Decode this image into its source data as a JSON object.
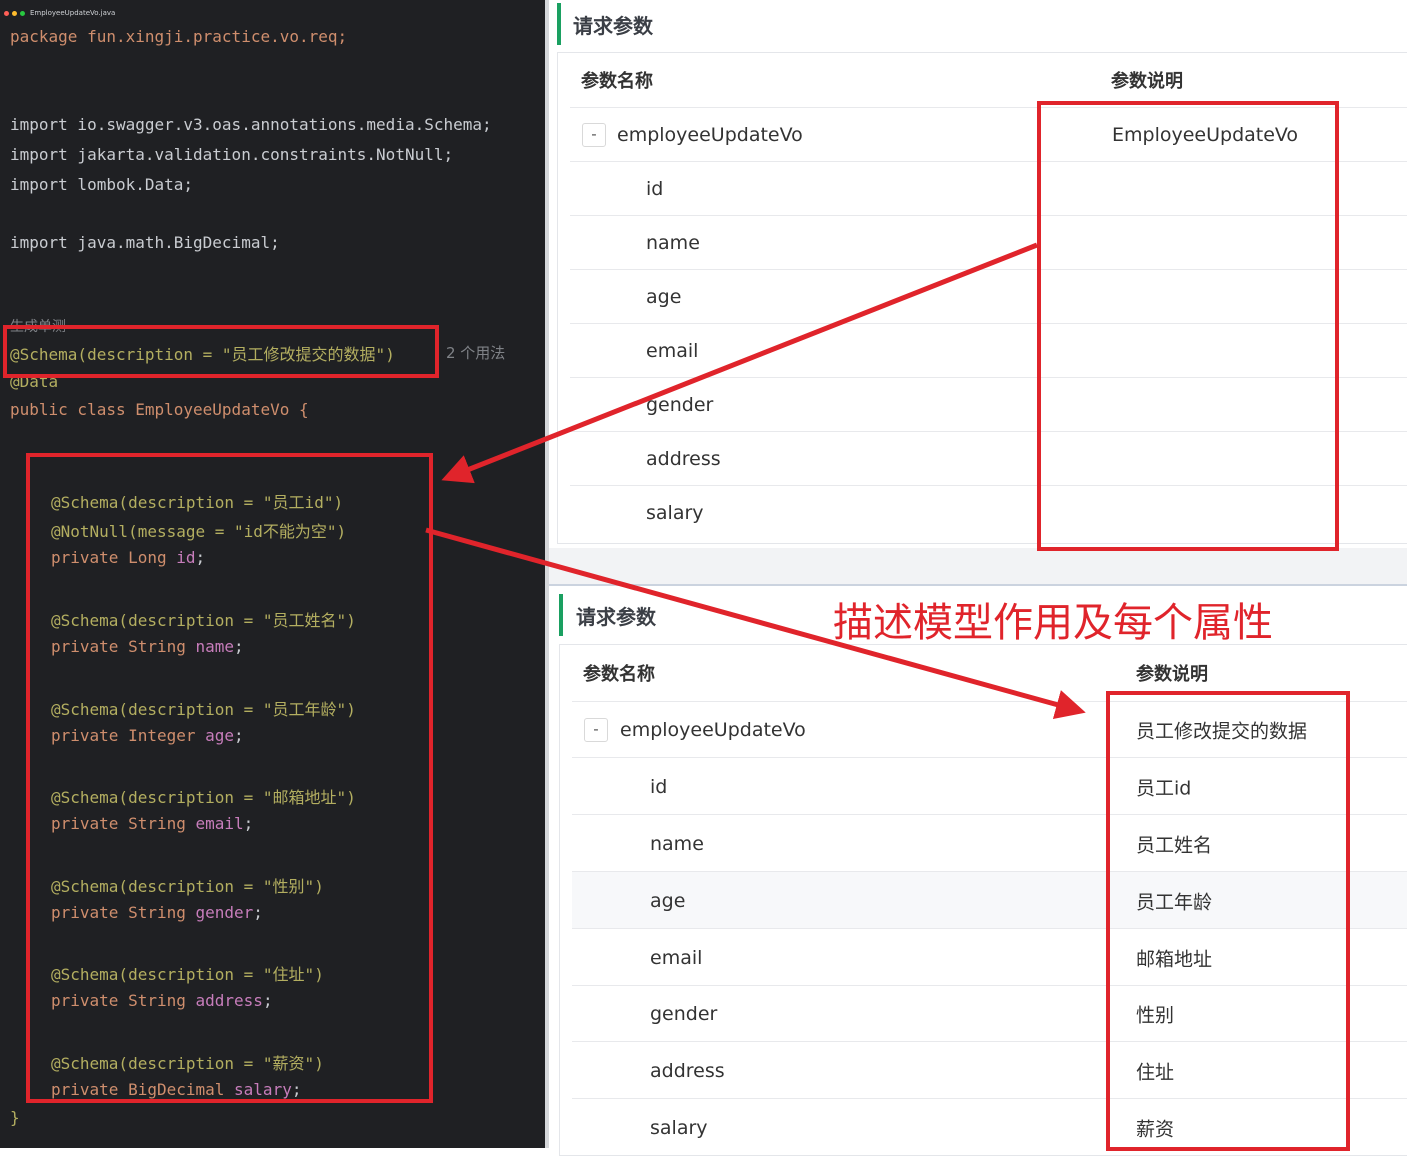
{
  "editor": {
    "file_name": "EmployeeUpdateVo.java",
    "lines": {
      "package": "package fun.xingji.practice.vo.req;",
      "import_schema": "import io.swagger.v3.oas.annotations.media.Schema;",
      "import_notnull": "import jakarta.validation.constraints.NotNull;",
      "import_data": "import lombok.Data;",
      "import_bigdecimal": "import java.math.BigDecimal;",
      "hint_generate": "生成单测",
      "class_schema": "@Schema(description = \"员工修改提交的数据\")",
      "usages": "2 个用法",
      "data_ann": "@Data",
      "class_decl": "public class EmployeeUpdateVo {",
      "closing_brace": "}"
    },
    "fields": [
      {
        "schema": "@Schema(description = \"员工id\")",
        "extra": "@NotNull(message = \"id不能为空\")",
        "decl_type": "private Long ",
        "decl_name": "id"
      },
      {
        "schema": "@Schema(description = \"员工姓名\")",
        "decl_type": "private String ",
        "decl_name": "name"
      },
      {
        "schema": "@Schema(description = \"员工年龄\")",
        "decl_type": "private Integer ",
        "decl_name": "age"
      },
      {
        "schema": "@Schema(description = \"邮箱地址\")",
        "decl_type": "private String ",
        "decl_name": "email"
      },
      {
        "schema": "@Schema(description = \"性别\")",
        "decl_type": "private String ",
        "decl_name": "gender"
      },
      {
        "schema": "@Schema(description = \"住址\")",
        "decl_type": "private String ",
        "decl_name": "address"
      },
      {
        "schema": "@Schema(description = \"薪资\")",
        "decl_type": "private BigDecimal ",
        "decl_name": "salary"
      }
    ]
  },
  "top_panel": {
    "title": "请求参数",
    "col_name": "参数名称",
    "col_desc": "参数说明",
    "root": {
      "toggle": "-",
      "name": "employeeUpdateVo",
      "desc": "EmployeeUpdateVo"
    },
    "rows": [
      {
        "name": "id",
        "desc": ""
      },
      {
        "name": "name",
        "desc": ""
      },
      {
        "name": "age",
        "desc": ""
      },
      {
        "name": "email",
        "desc": ""
      },
      {
        "name": "gender",
        "desc": ""
      },
      {
        "name": "address",
        "desc": ""
      },
      {
        "name": "salary",
        "desc": ""
      }
    ]
  },
  "bottom_panel": {
    "title": "请求参数",
    "col_name": "参数名称",
    "col_desc": "参数说明",
    "root": {
      "toggle": "-",
      "name": "employeeUpdateVo",
      "desc": "员工修改提交的数据"
    },
    "rows": [
      {
        "name": "id",
        "desc": "员工id"
      },
      {
        "name": "name",
        "desc": "员工姓名"
      },
      {
        "name": "age",
        "desc": "员工年龄"
      },
      {
        "name": "email",
        "desc": "邮箱地址"
      },
      {
        "name": "gender",
        "desc": "性别"
      },
      {
        "name": "address",
        "desc": "住址"
      },
      {
        "name": "salary",
        "desc": "薪资"
      }
    ]
  },
  "annotation": {
    "caption": "描述模型作用及每个属性",
    "color": "#e0242b"
  },
  "colors": {
    "editor_bg": "#1f2023",
    "keyword": "#cf8e6d",
    "annotation": "#b3ae60",
    "string": "#6aab73",
    "field": "#c77dbb",
    "accent_green": "#1aa061"
  }
}
